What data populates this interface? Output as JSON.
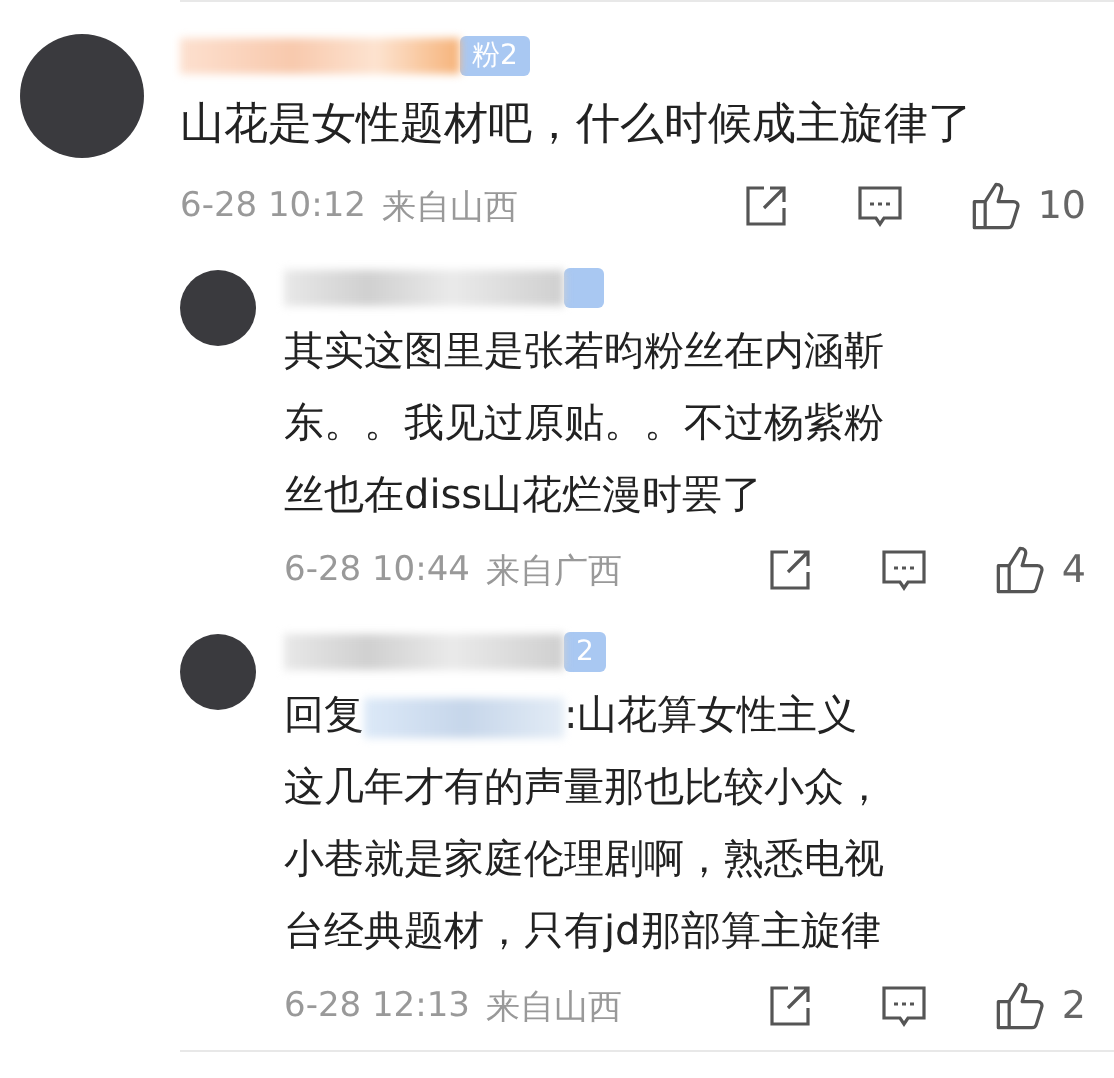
{
  "comment": {
    "badge": "粉2",
    "text": "山花是女性题材吧，什么时候成主旋律了",
    "time": "6-28 10:12",
    "location": "来自山西",
    "likes": "10",
    "replies": [
      {
        "text": "其实这图里是张若昀粉丝在内涵靳东。。我见过原贴。。不过杨紫粉丝也在diss山花烂漫时罢了",
        "time": "6-28 10:44",
        "location": "来自广西",
        "likes": "4"
      },
      {
        "badge": "2",
        "prefix": "回复",
        "text": ":山花算女性主义这几年才有的声量那也比较小众，小巷就是家庭伦理剧啊，熟悉电视台经典题材，只有jd那部算主旋律",
        "time": "6-28 12:13",
        "location": "来自山西",
        "likes": "2"
      }
    ]
  }
}
